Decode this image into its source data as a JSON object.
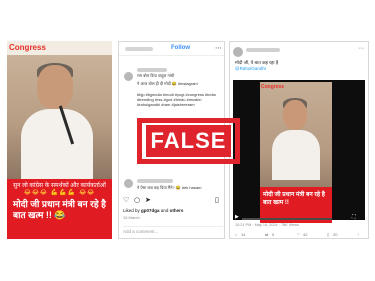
{
  "stamp": {
    "label": "FALSE",
    "color": "#e0242e"
  },
  "panel1": {
    "brand": "Congress",
    "caption_line1": "सुन लो कांग्रेस के समर्थकों और कार्यकर्ताओं",
    "caption_emojis": "😂😂😂 💪💪💪 😂😂",
    "caption_line2": "मोदी जी प्रधान मंत्री बन रहे है बात खत्म !! 😂"
  },
  "panel2": {
    "follow_label": "Follow",
    "post_text_1": "राम बोल दिया चाहुल गांधी",
    "post_text_2": "ने आज बोल ही दी मोदी 😂 #instagram",
    "hashtags": "#bjp #bjpindia #modi #yogi #congress #india #trending #rss #god #hindu #muslim #rahulgandhi #ram #jaishreeram",
    "comment_text": "ने ऐसा कब कह दिया मैंने? 😂 #ek hasam",
    "days_ago": "13 hours ago",
    "liked_by": "Liked by",
    "liked_user": "gp07dga",
    "liked_and": "and",
    "liked_others": "others",
    "date_label": "15 March",
    "add_comment": "Add a comment..."
  },
  "panel3": {
    "post_text": "मोदी जी, ये बात कह रहा है",
    "handle": "@RahulGandhi",
    "brand": "Congress",
    "caption": "मोदी जी प्रधान मंत्री बन रहे है बात खत्म !!",
    "meta": "10:21 PM · May 14, 2024 · 78K Views",
    "actions": [
      "14",
      "5",
      "42",
      "20"
    ]
  }
}
